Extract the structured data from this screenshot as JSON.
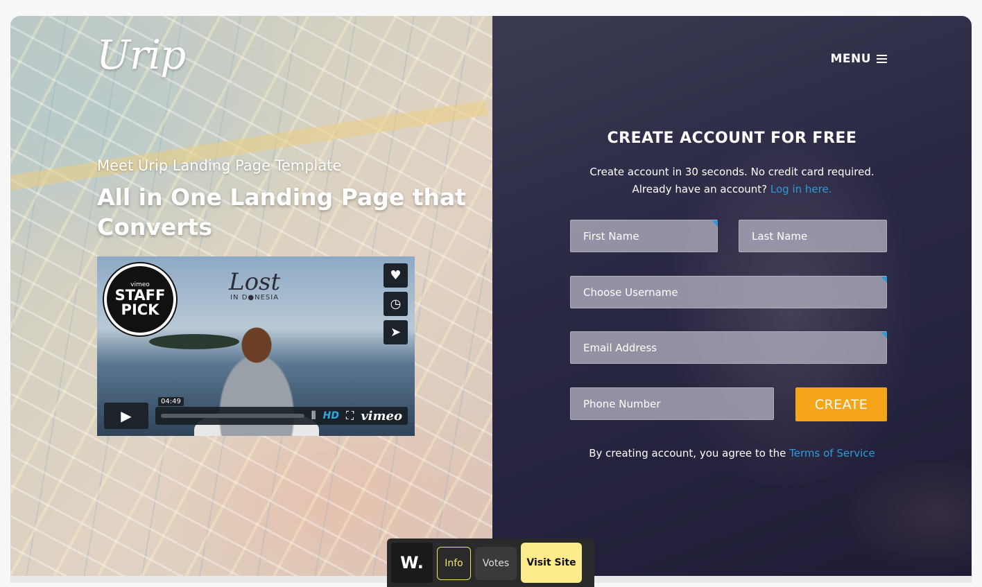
{
  "brand": {
    "logo": "Urip"
  },
  "hero": {
    "pre_title": "Meet Urip Landing Page Template",
    "headline": "All in One Landing Page that Converts"
  },
  "video": {
    "badge_top": "vimeo",
    "badge_main": "STAFF PICK",
    "title_line1": "Lost",
    "title_line2": "IN D●NESIA",
    "time": "04:49",
    "hd": "HD",
    "provider": "vimeo"
  },
  "nav": {
    "menu_label": "MENU"
  },
  "form": {
    "title": "CREATE ACCOUNT FOR FREE",
    "subtitle": "Create account in 30 seconds. No credit card required.",
    "login_prompt": "Already have an account?",
    "login_link": "Log in here.",
    "first_name_placeholder": "First Name",
    "last_name_placeholder": "Last Name",
    "username_placeholder": "Choose Username",
    "email_placeholder": "Email Address",
    "phone_placeholder": "Phone Number",
    "submit_label": "CREATE",
    "terms_prefix": "By creating account, you agree to the",
    "terms_link": "Terms of Service"
  },
  "toolbar": {
    "logo": "W.",
    "info_label": "Info",
    "votes_label": "Votes",
    "visit_label": "Visit Site"
  },
  "colors": {
    "accent_orange": "#f5a518",
    "link_blue": "#2e9bd8",
    "dark_panel": "#2a2944",
    "toolbar_yellow": "#fbeb8a"
  }
}
